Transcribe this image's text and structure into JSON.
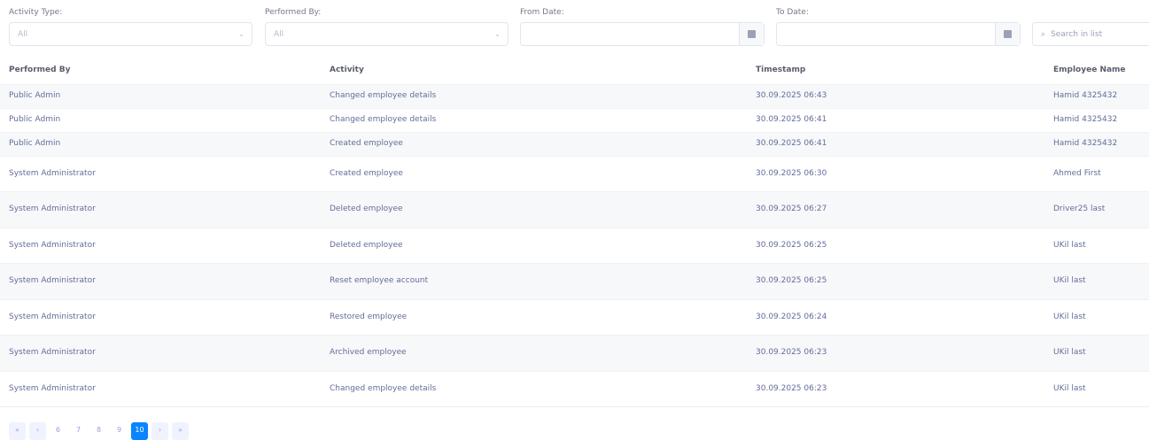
{
  "filters": {
    "activity_type": {
      "label": "Activity Type:",
      "value": "All"
    },
    "performed_by": {
      "label": "Performed By:",
      "value": "All"
    },
    "from_date": {
      "label": "From Date:",
      "value": ""
    },
    "to_date": {
      "label": "To Date:",
      "value": ""
    },
    "search": {
      "placeholder": "Search in list"
    }
  },
  "table": {
    "headers": [
      "Performed By",
      "Activity",
      "Timestamp",
      "Employee Name"
    ],
    "rows": [
      {
        "by": "Public Admin",
        "activity": "Changed employee details",
        "ts": "30.09.2025 06:43",
        "emp": "Hamid 4325432"
      },
      {
        "by": "Public Admin",
        "activity": "Changed employee details",
        "ts": "30.09.2025 06:41",
        "emp": "Hamid 4325432"
      },
      {
        "by": "Public Admin",
        "activity": "Created employee",
        "ts": "30.09.2025 06:41",
        "emp": "Hamid 4325432"
      },
      {
        "by": "System Administrator",
        "activity": "Created employee",
        "ts": "30.09.2025 06:30",
        "emp": "Ahmed First"
      },
      {
        "by": "System Administrator",
        "activity": "Deleted employee",
        "ts": "30.09.2025 06:27",
        "emp": "Driver25 last"
      },
      {
        "by": "System Administrator",
        "activity": "Deleted employee",
        "ts": "30.09.2025 06:25",
        "emp": "UKil last"
      },
      {
        "by": "System Administrator",
        "activity": "Reset employee account",
        "ts": "30.09.2025 06:25",
        "emp": "UKil last"
      },
      {
        "by": "System Administrator",
        "activity": "Restored employee",
        "ts": "30.09.2025 06:24",
        "emp": "UKil last"
      },
      {
        "by": "System Administrator",
        "activity": "Archived employee",
        "ts": "30.09.2025 06:23",
        "emp": "UKil last"
      },
      {
        "by": "System Administrator",
        "activity": "Changed employee details",
        "ts": "30.09.2025 06:23",
        "emp": "UKil last"
      }
    ]
  },
  "pagination": {
    "first": "«",
    "prev": "‹",
    "pages": [
      "6",
      "7",
      "8",
      "9",
      "10"
    ],
    "active": "10",
    "next": "›",
    "last": "»"
  }
}
